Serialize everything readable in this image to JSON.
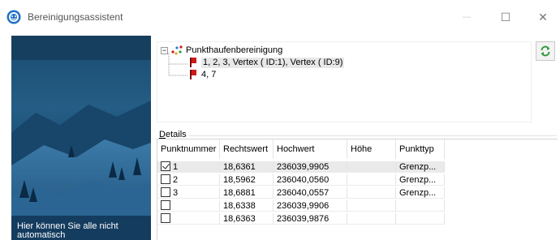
{
  "window": {
    "title": "Bereinigungsassistent",
    "controls": {
      "minimize": "—",
      "maximize": "☐",
      "close": "✕"
    }
  },
  "sidebar": {
    "text": "Hier können Sie alle nicht automatisch"
  },
  "tree": {
    "root": {
      "label": "Punkthaufenbereinigung",
      "icon": "point-cloud-icon",
      "expander": "−"
    },
    "children": [
      {
        "label": "1, 2, 3, Vertex ( ID:1), Vertex ( ID:9)",
        "icon": "red-flag-icon",
        "selected": true
      },
      {
        "label": "4, 7",
        "icon": "red-flag-icon",
        "selected": false
      }
    ]
  },
  "refresh_button": {
    "icon": "refresh-icon"
  },
  "details": {
    "label_accel": "D",
    "label_rest": "etails",
    "columns": [
      "Punktnummer",
      "Rechtswert",
      "Hochwert",
      "Höhe",
      "Punkttyp"
    ],
    "rows": [
      {
        "checked": true,
        "cells": [
          "1",
          "18,6361",
          "236039,9905",
          "",
          "Grenzp..."
        ]
      },
      {
        "checked": false,
        "cells": [
          "2",
          "18,5962",
          "236040,0560",
          "",
          "Grenzp..."
        ]
      },
      {
        "checked": false,
        "cells": [
          "3",
          "18,6881",
          "236040,0557",
          "",
          "Grenzp..."
        ]
      },
      {
        "checked": false,
        "cells": [
          "",
          "18,6338",
          "236039,9906",
          "",
          ""
        ]
      },
      {
        "checked": false,
        "cells": [
          "",
          "18,6363",
          "236039,9876",
          "",
          ""
        ]
      }
    ]
  },
  "colors": {
    "accent_blue": "#1e6fc8",
    "flag_red": "#cc1a1a",
    "refresh_green": "#2f9a3a",
    "selection": "#eaeaea"
  }
}
